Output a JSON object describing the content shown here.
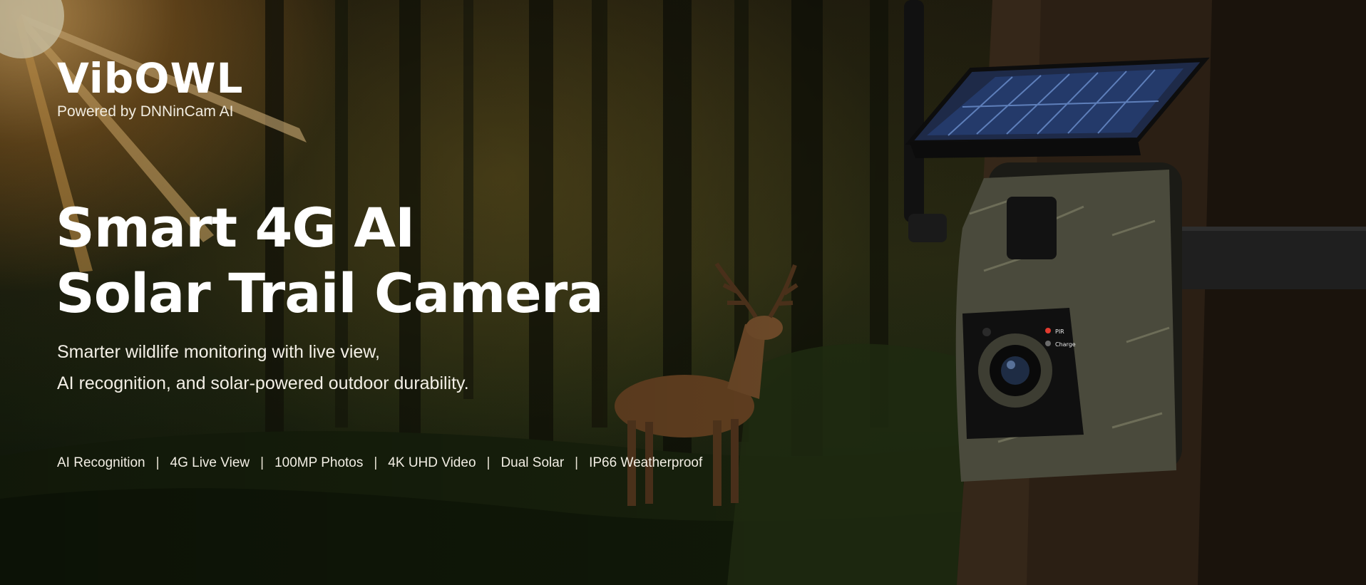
{
  "brand": {
    "logo": "VibOWL",
    "tagline": "Powered by DNNinCam AI"
  },
  "headline": {
    "line1": "Smart 4G AI",
    "line2": "Solar Trail Camera"
  },
  "subtitle": {
    "line1": "Smarter wildlife monitoring with live view,",
    "line2": "AI recognition, and solar-powered outdoor durability."
  },
  "features": [
    "AI Recognition",
    "4G Live View",
    "100MP Photos",
    "4K UHD Video",
    "Dual Solar",
    "IP66 Weatherproof"
  ],
  "camera": {
    "indicators": {
      "pir": "PIR",
      "charge": "Charge"
    }
  },
  "colors": {
    "sunlight": "#ffc46e",
    "forest_dark": "#0f1509",
    "camo": "#4a4a3c",
    "pir_led": "#e23b2f"
  }
}
